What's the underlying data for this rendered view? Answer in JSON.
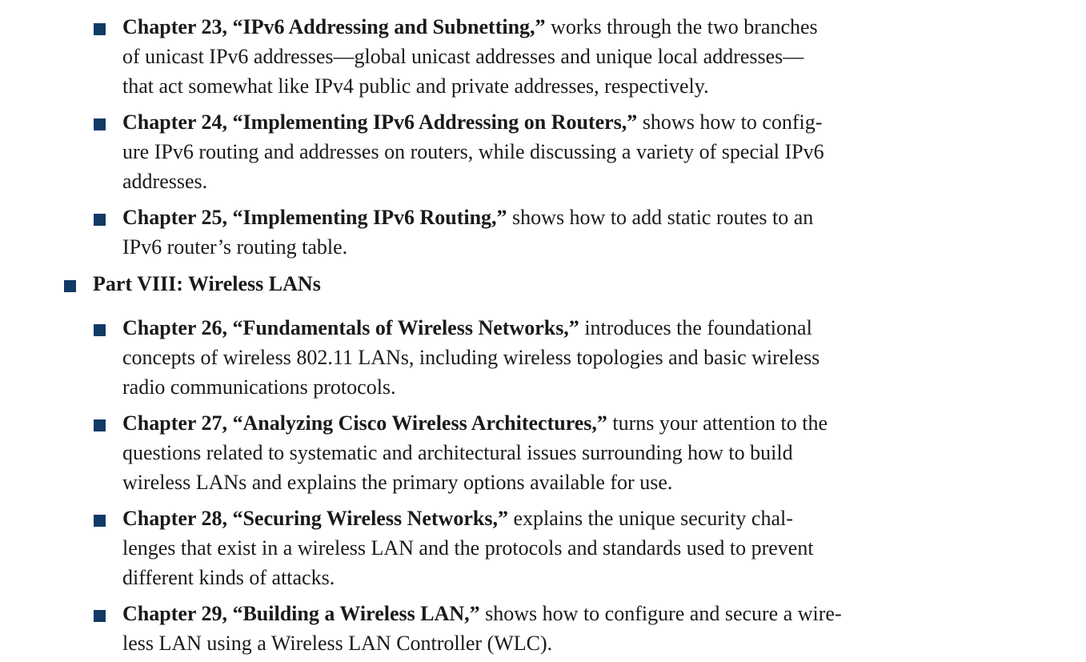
{
  "colors": {
    "bullet": "#123a66",
    "text": "#1a1a1a"
  },
  "items": {
    "ch23": {
      "bold": "Chapter 23, “IPv6 Addressing and Subnetting,”",
      "l1": " works through the two branches",
      "l2": "of unicast IPv6 addresses—global unicast addresses and unique local addresses—",
      "l3": "that act somewhat like IPv4 public and private addresses, respectively."
    },
    "ch24": {
      "bold": "Chapter 24, “Implementing IPv6 Addressing on Routers,”",
      "l1": " shows how to config-",
      "l2": "ure IPv6 routing and addresses on routers, while discussing a variety of special IPv6",
      "l3": "addresses."
    },
    "ch25": {
      "bold": "Chapter 25, “Implementing IPv6 Routing,”",
      "l1": " shows how to add static routes to an",
      "l2": "IPv6 router’s routing table."
    },
    "part8": {
      "bold": "Part VIII: Wireless LANs"
    },
    "ch26": {
      "bold": "Chapter 26, “Fundamentals of Wireless Networks,”",
      "l1": " introduces the foundational",
      "l2": "concepts of wireless 802.11 LANs, including wireless topologies and basic wireless",
      "l3": "radio communications protocols."
    },
    "ch27": {
      "bold": "Chapter 27, “Analyzing Cisco Wireless Architectures,”",
      "l1": " turns your attention to the",
      "l2": "questions related to systematic and architectural issues surrounding how to build",
      "l3": "wireless LANs and explains the primary options available for use."
    },
    "ch28": {
      "bold": "Chapter 28, “Securing Wireless Networks,”",
      "l1": " explains the unique security chal-",
      "l2": "lenges that exist in a wireless LAN and the protocols and standards used to prevent",
      "l3": "different kinds of attacks."
    },
    "ch29": {
      "bold": "Chapter 29, “Building a Wireless LAN,”",
      "l1": " shows how to configure and secure a wire-",
      "l2": "less LAN using a Wireless LAN Controller (WLC)."
    }
  }
}
